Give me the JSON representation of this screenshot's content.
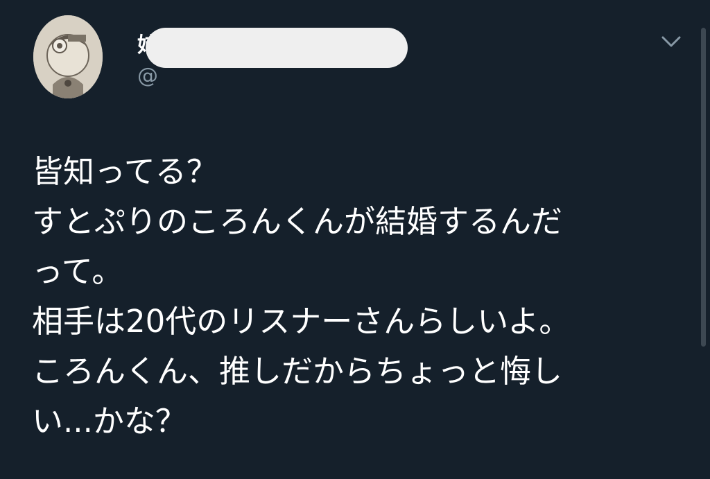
{
  "author": {
    "display_name": "姉",
    "handle": "@"
  },
  "tweet": {
    "lines": [
      "皆知ってる？",
      "すとぷりのころんくんが結婚するんだ",
      "って。",
      "相手は20代のリスナーさんらしいよ。",
      "ころんくん、推しだからちょっと悔し",
      "い...かな？"
    ]
  },
  "icons": {
    "avatar": "avatar-image",
    "menu": "chevron-down-icon"
  },
  "colors": {
    "background": "#15202b",
    "text": "#ffffff",
    "secondary_text": "#8899a6",
    "redaction": "#efefef"
  }
}
